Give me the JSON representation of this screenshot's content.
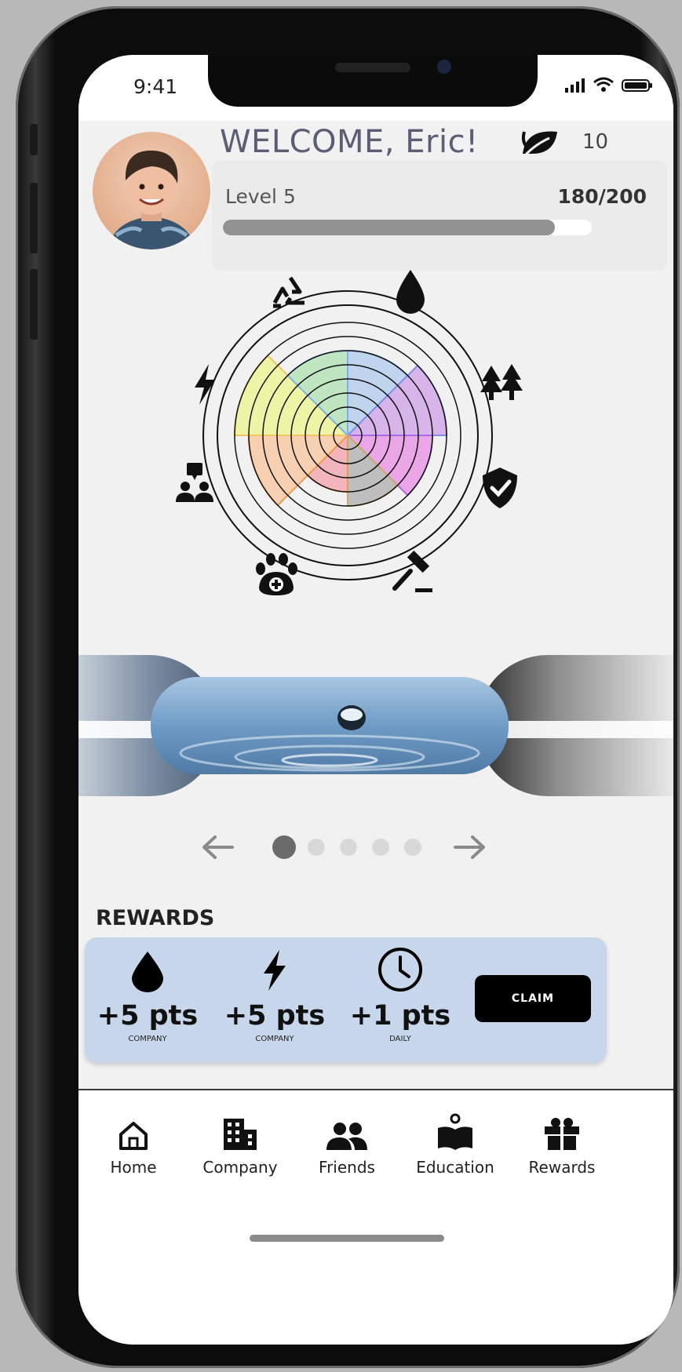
{
  "status_bar": {
    "time": "9:41"
  },
  "header": {
    "welcome": "WELCOME, Eric!",
    "leaf_count": "10",
    "level_label": "Level 5",
    "xp_text": "180/200",
    "progress": 0.9
  },
  "chart_data": {
    "type": "radial-bar",
    "rings": 8,
    "categories": [
      "water",
      "forest",
      "security",
      "legal",
      "animal care",
      "community",
      "energy",
      "recycling"
    ],
    "values": [
      6,
      7,
      6,
      5,
      4,
      7,
      8,
      6
    ],
    "colors": {
      "water": "#c0d4ee",
      "forest": "#d7b4ea",
      "security": "#eaa6e6",
      "legal": "#bebebe",
      "animal care": "#f3b5bd",
      "community": "#f7d0b2",
      "energy": "#eef4a5",
      "recycling": "#bfe6c1"
    }
  },
  "pager": {
    "pages": 5,
    "active": 0
  },
  "rewards": {
    "title": "REWARDS",
    "items": [
      {
        "icon": "water-drop-icon",
        "points": "+5 pts",
        "label": "COMPANY"
      },
      {
        "icon": "lightning-icon",
        "points": "+5 pts",
        "label": "COMPANY"
      },
      {
        "icon": "clock-icon",
        "points": "+1 pts",
        "label": "DAILY"
      }
    ],
    "claim_label": "CLAIM"
  },
  "tabs": [
    {
      "icon": "home-icon",
      "label": "Home"
    },
    {
      "icon": "building-icon",
      "label": "Company"
    },
    {
      "icon": "friends-icon",
      "label": "Friends"
    },
    {
      "icon": "education-icon",
      "label": "Education"
    },
    {
      "icon": "gift-icon",
      "label": "Rewards"
    }
  ]
}
